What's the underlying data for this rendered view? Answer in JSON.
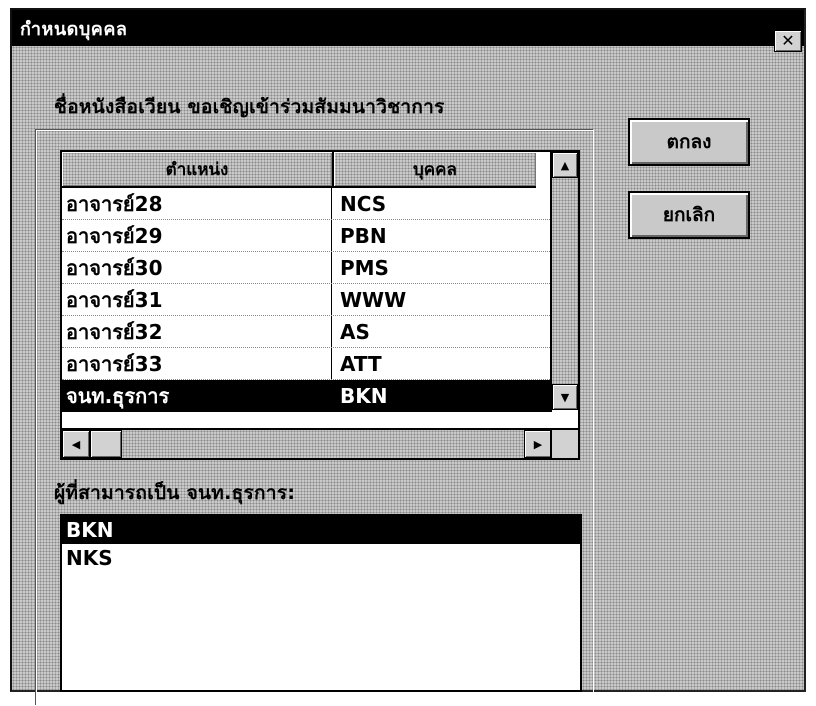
{
  "window": {
    "title": "กำหนดบุคคล",
    "close_glyph": "✕"
  },
  "group": {
    "label": "ชื่อหนังสือเวียน ขอเชิญเข้าร่วมสัมมนาวิชาการ"
  },
  "grid": {
    "columns": [
      "ตำแหน่ง",
      "บุคคล"
    ],
    "rows": [
      {
        "position": "อาจารย์28",
        "person": "NCS"
      },
      {
        "position": "อาจารย์29",
        "person": "PBN"
      },
      {
        "position": "อาจารย์30",
        "person": "PMS"
      },
      {
        "position": "อาจารย์31",
        "person": "WWW"
      },
      {
        "position": "อาจารย์32",
        "person": "AS"
      },
      {
        "position": "อาจารย์33",
        "person": "ATT"
      },
      {
        "position": "จนท.ธุรการ",
        "person": "BKN"
      }
    ],
    "selected_row": 6
  },
  "list": {
    "label": "ผู้ที่สามารถเป็น จนท.ธุรการ:",
    "items": [
      "BKN",
      "NKS"
    ],
    "selected_index": 0
  },
  "buttons": {
    "ok": "ตกลง",
    "cancel": "ยกเลิก"
  },
  "icons": {
    "scroll_up": "▲",
    "scroll_down": "▼",
    "scroll_left": "◀",
    "scroll_right": "▶"
  }
}
